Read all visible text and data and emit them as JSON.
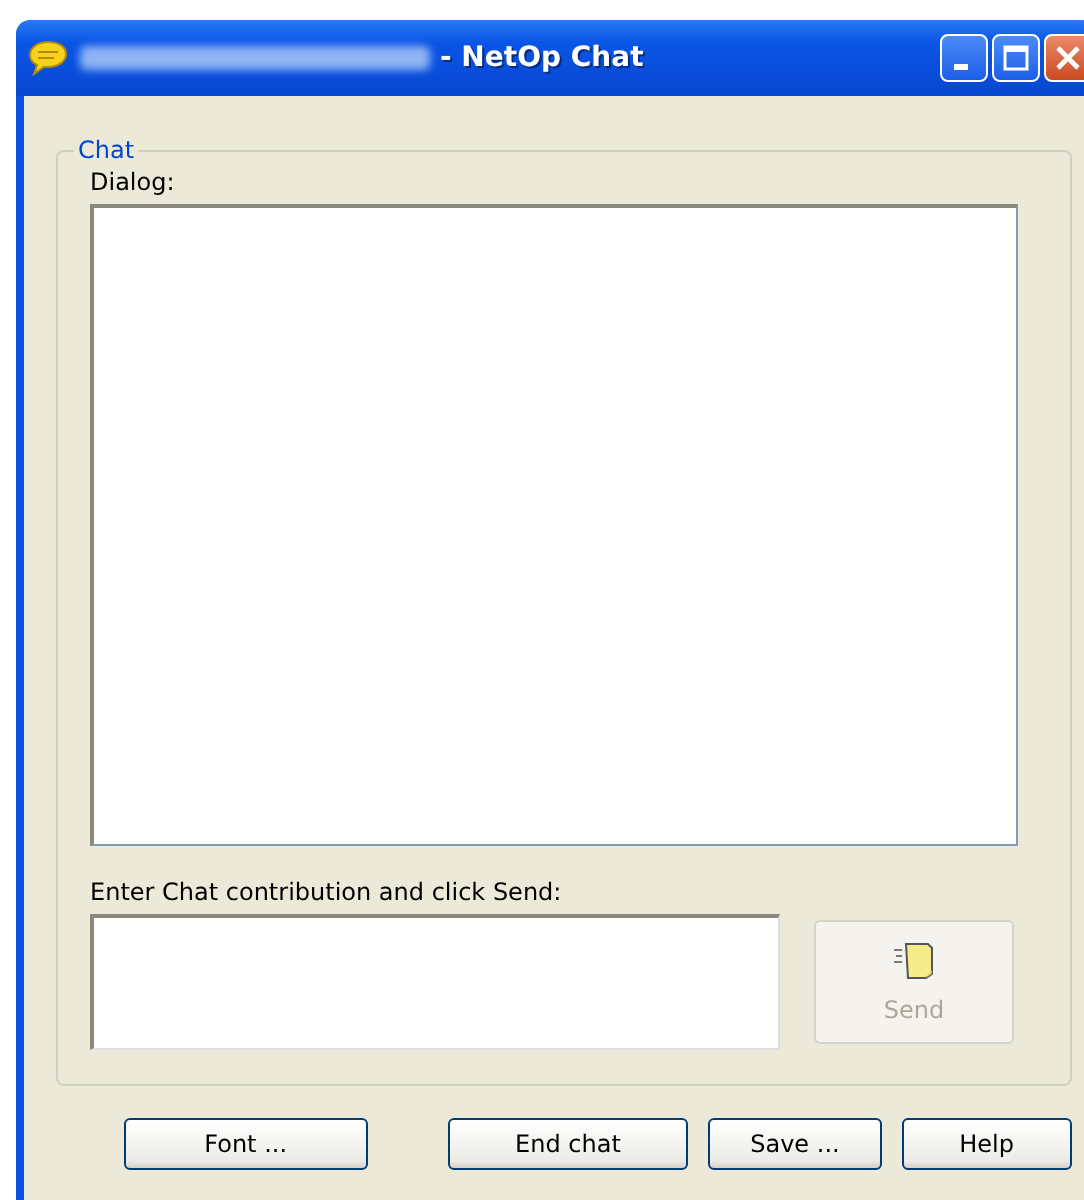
{
  "window": {
    "title": "- NetOp Chat",
    "title_obscured": true
  },
  "group": {
    "title": "Chat",
    "dialog_label": "Dialog:",
    "entry_label": "Enter Chat contribution and click Send:"
  },
  "send_button": {
    "label": "Send",
    "disabled": true
  },
  "buttons": [
    {
      "label": "Font ..."
    },
    {
      "label": "End chat"
    },
    {
      "label": "Save ..."
    },
    {
      "label": "Help"
    }
  ]
}
